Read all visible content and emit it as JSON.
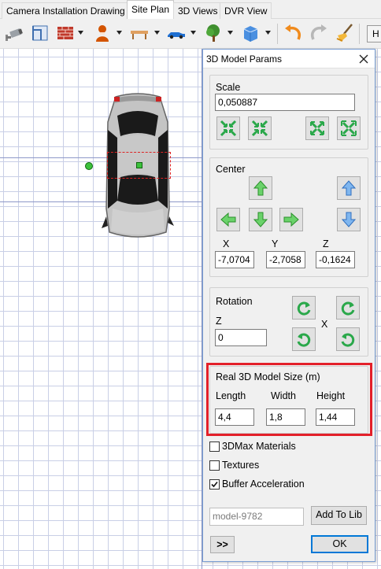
{
  "tabs": [
    {
      "label": "Camera Installation Drawing"
    },
    {
      "label": "Site Plan",
      "active": true
    },
    {
      "label": "3D Views"
    },
    {
      "label": "DVR View"
    }
  ],
  "toolbar": {
    "icons": [
      "camera-icon",
      "wall-icon",
      "brick-wall-icon",
      "person-icon",
      "bench-icon",
      "car-icon",
      "tree-icon",
      "cube-icon",
      "undo-icon",
      "redo-icon",
      "broom-icon"
    ],
    "h_button_label": "H"
  },
  "dialog": {
    "title": "3D Model Params",
    "scale": {
      "label": "Scale",
      "value": "0,050887"
    },
    "center": {
      "label": "Center",
      "x_label": "X",
      "y_label": "Y",
      "z_label": "Z",
      "x_value": "-7,0704",
      "y_value": "-2,7058",
      "z_value": "-0,1624"
    },
    "rotation": {
      "label": "Rotation",
      "z_label": "Z",
      "z_value": "0",
      "x_label": "X"
    },
    "real_size": {
      "label": "Real 3D Model Size (m)",
      "length_label": "Length",
      "width_label": "Width",
      "height_label": "Height",
      "length_value": "4,4",
      "width_value": "1,8",
      "height_value": "1,44"
    },
    "options": [
      {
        "label": "3DMax Materials",
        "checked": false
      },
      {
        "label": "Textures",
        "checked": false
      },
      {
        "label": "Buffer Acceleration",
        "checked": true
      }
    ],
    "model_name": "model-9782",
    "add_to_lib_label": "Add To Lib",
    "more_label": ">>",
    "ok_label": "OK"
  },
  "colors": {
    "highlight_box": "#e3202a",
    "grid": "#c9cfe6",
    "handle_green": "#3cc13c"
  }
}
